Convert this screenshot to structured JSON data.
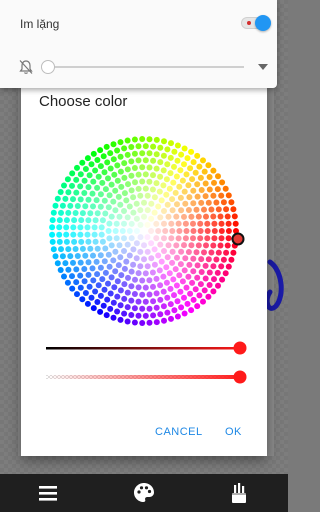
{
  "volume_panel": {
    "title": "Im lặng",
    "toggle_on": true,
    "volume_level": 0
  },
  "dialog": {
    "title": "Choose color",
    "cancel_label": "CANCEL",
    "ok_label": "OK",
    "selected_color": "#e53935",
    "saturation_level": 1.0,
    "alpha_level": 1.0
  },
  "colors": {
    "accent": "#1e88e5",
    "toggle": "#2196f3",
    "slider_thumb": "#ff1a1a",
    "stroke": "#1a1aa6",
    "toolbar_bg": "#1f1f1f"
  },
  "toolbar": {
    "icons": [
      "menu-icon",
      "palette-icon",
      "brush-icon"
    ]
  }
}
